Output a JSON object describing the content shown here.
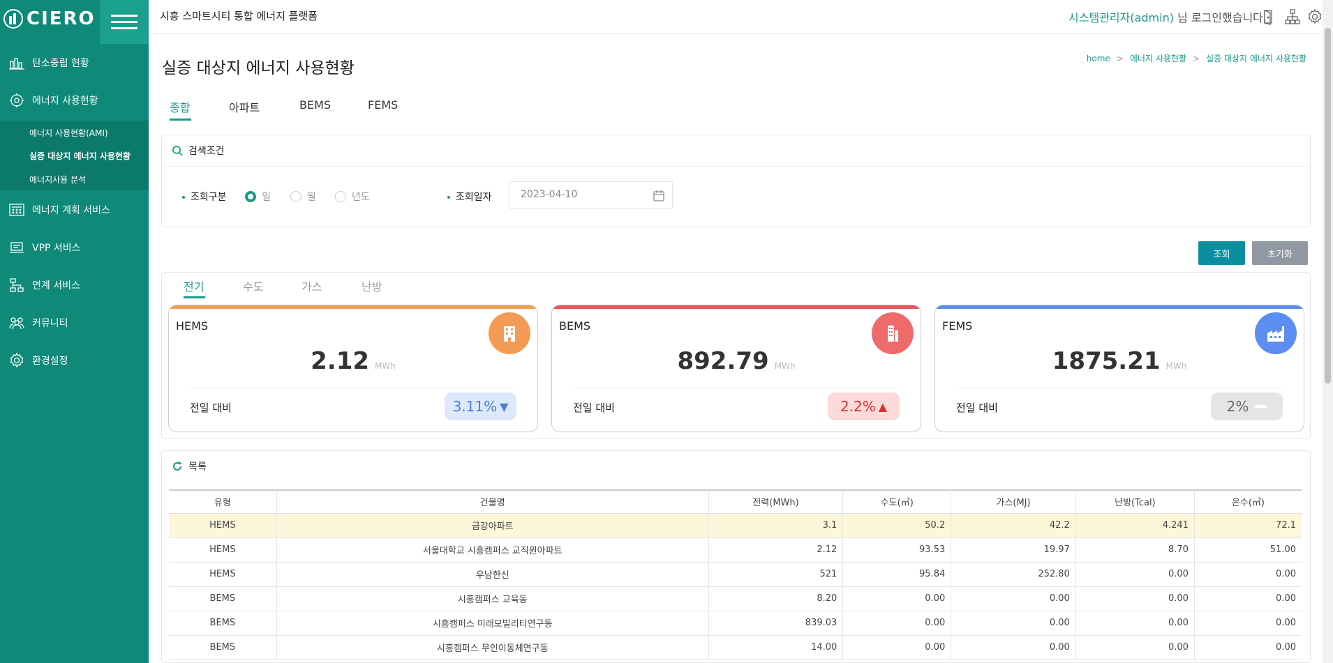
{
  "app": {
    "logo": "CIERO",
    "platform_title": "시흥 스마트시티 통합 에너지 플랫폼"
  },
  "header": {
    "user_name": "시스템관리자(admin)",
    "login_suffix": " 님 로그인했습니다."
  },
  "sidebar": {
    "items": [
      {
        "label": "탄소중립 현황",
        "icon": "chart-building-icon"
      },
      {
        "label": "에너지 사용현황",
        "icon": "energy-gear-icon"
      },
      {
        "label": "에너지 계획 서비스",
        "icon": "calculator-icon"
      },
      {
        "label": "VPP 서비스",
        "icon": "laptop-icon"
      },
      {
        "label": "연계 서비스",
        "icon": "network-icon"
      },
      {
        "label": "커뮤니티",
        "icon": "people-icon"
      },
      {
        "label": "환경설정",
        "icon": "gear-icon"
      }
    ],
    "subitems": [
      {
        "label": "에너지 사용현황(AMI)",
        "active": false
      },
      {
        "label": "실증 대상지 에너지 사용현황",
        "active": true
      },
      {
        "label": "에너지사용 분석",
        "active": false
      }
    ]
  },
  "page": {
    "title": "실증 대상지 에너지 사용현황"
  },
  "breadcrumb": [
    "home",
    "에너지 사용현황",
    "실증 대상지 에너지 사용현황"
  ],
  "tabs": [
    "종합",
    "아파트",
    "BEMS",
    "FEMS"
  ],
  "search": {
    "header": "검색조건",
    "type_label": "조회구분",
    "options": [
      "일",
      "월",
      "년도"
    ],
    "date_label": "조회일자",
    "date_value": "2023-04-10",
    "search_button": "조회",
    "reset_button": "초기화"
  },
  "energy_tabs": [
    "전기",
    "수도",
    "가스",
    "난방"
  ],
  "cards": [
    {
      "title": "HEMS",
      "value": "2.12",
      "unit": "MWh",
      "compare_label": "전일 대비",
      "change": "3.11%",
      "direction": "down",
      "accent": "#f0a050",
      "icon_bg": "#f39a55",
      "badge_bg": "#dde8f8",
      "badge_color": "#4a7fd6"
    },
    {
      "title": "BEMS",
      "value": "892.79",
      "unit": "MWh",
      "compare_label": "전일 대비",
      "change": "2.2%",
      "direction": "up",
      "accent": "#e8545a",
      "icon_bg": "#ef6a6a",
      "badge_bg": "#fbdada",
      "badge_color": "#e0302e"
    },
    {
      "title": "FEMS",
      "value": "1875.21",
      "unit": "MWh",
      "compare_label": "전일 대비",
      "change": "2%",
      "direction": "flat",
      "accent": "#5a8ee8",
      "icon_bg": "#5b8ef0",
      "badge_bg": "#e5e5e5",
      "badge_color": "#666"
    }
  ],
  "list": {
    "header": "목록",
    "columns": [
      "유형",
      "건물명",
      "전력(MWh)",
      "수도(㎥)",
      "가스(MJ)",
      "난방(Tcal)",
      "온수(㎥)"
    ],
    "rows": [
      [
        "HEMS",
        "금강아파트",
        "3.1",
        "50.2",
        "42.2",
        "4.241",
        "72.1"
      ],
      [
        "HEMS",
        "서울대학교 시흥캠퍼스 교직원아파트",
        "2.12",
        "93.53",
        "19.97",
        "8.70",
        "51.00"
      ],
      [
        "HEMS",
        "우남한신",
        "521",
        "95.84",
        "252.80",
        "0.00",
        "0.00"
      ],
      [
        "BEMS",
        "시흥캠퍼스 교육동",
        "8.20",
        "0.00",
        "0.00",
        "0.00",
        "0.00"
      ],
      [
        "BEMS",
        "시흥캠퍼스 미래모빌리티연구동",
        "839.03",
        "0.00",
        "0.00",
        "0.00",
        "0.00"
      ],
      [
        "BEMS",
        "시흥캠퍼스 무인이동체연구동",
        "14.00",
        "0.00",
        "0.00",
        "0.00",
        "0.00"
      ]
    ]
  }
}
